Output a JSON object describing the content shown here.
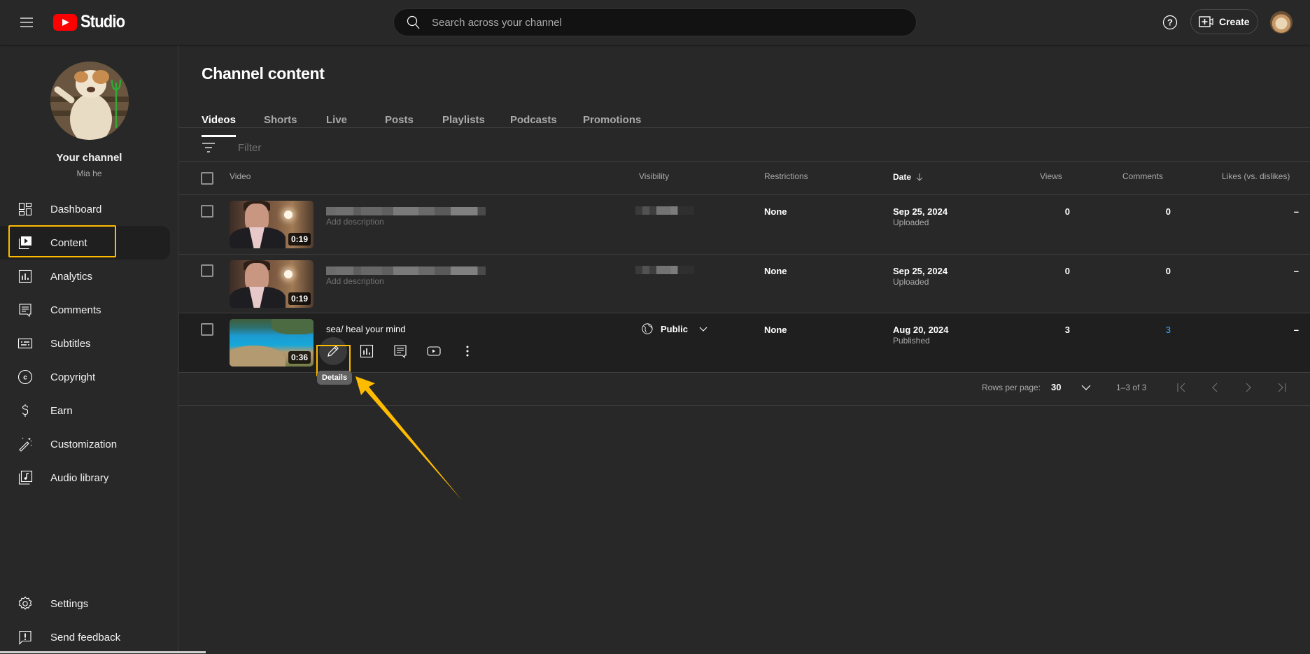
{
  "header": {
    "logo_text": "Studio",
    "search_placeholder": "Search across your channel",
    "create_label": "Create"
  },
  "sidebar": {
    "channel_title": "Your channel",
    "channel_name": "Mia he",
    "items": [
      {
        "label": "Dashboard",
        "icon": "dashboard-icon"
      },
      {
        "label": "Content",
        "icon": "content-icon",
        "active": true
      },
      {
        "label": "Analytics",
        "icon": "analytics-icon"
      },
      {
        "label": "Comments",
        "icon": "comments-icon"
      },
      {
        "label": "Subtitles",
        "icon": "subtitles-icon"
      },
      {
        "label": "Copyright",
        "icon": "copyright-icon"
      },
      {
        "label": "Earn",
        "icon": "dollar-icon"
      },
      {
        "label": "Customization",
        "icon": "magic-wand-icon"
      },
      {
        "label": "Audio library",
        "icon": "audio-library-icon"
      }
    ],
    "bottom_items": [
      {
        "label": "Settings",
        "icon": "gear-icon"
      },
      {
        "label": "Send feedback",
        "icon": "feedback-icon"
      }
    ]
  },
  "main": {
    "title": "Channel content",
    "tabs": [
      {
        "label": "Videos",
        "active": true
      },
      {
        "label": "Shorts"
      },
      {
        "label": "Live"
      },
      {
        "label": "Posts"
      },
      {
        "label": "Playlists"
      },
      {
        "label": "Podcasts"
      },
      {
        "label": "Promotions"
      }
    ],
    "filter_placeholder": "Filter",
    "columns": {
      "video": "Video",
      "visibility": "Visibility",
      "restrictions": "Restrictions",
      "date": "Date",
      "views": "Views",
      "comments": "Comments",
      "likes": "Likes (vs. dislikes)"
    },
    "rows": [
      {
        "title": "",
        "title_redacted": true,
        "description": "Add description",
        "duration": "0:19",
        "visibility": "",
        "visibility_redacted": true,
        "restrictions": "None",
        "date": "Sep 25, 2024",
        "date_status": "Uploaded",
        "views": "0",
        "comments": "0",
        "likes": "–"
      },
      {
        "title": "",
        "title_redacted": true,
        "description": "Add description",
        "duration": "0:19",
        "visibility": "",
        "visibility_redacted": true,
        "restrictions": "None",
        "date": "Sep 25, 2024",
        "date_status": "Uploaded",
        "views": "0",
        "comments": "0",
        "likes": "–"
      },
      {
        "title": "sea/ heal your mind",
        "duration": "0:36",
        "visibility": "Public",
        "restrictions": "None",
        "date": "Aug 20, 2024",
        "date_status": "Published",
        "views": "3",
        "comments": "3",
        "likes": "–"
      }
    ],
    "row_actions_tooltip": "Details",
    "pagination": {
      "rows_per_page_label": "Rows per page:",
      "rows_per_page": "30",
      "range": "1–3 of 3"
    }
  },
  "colors": {
    "accent_highlight": "#ffbb00",
    "link_blue": "#3ea6ff",
    "youtube_red": "#ff0000"
  }
}
